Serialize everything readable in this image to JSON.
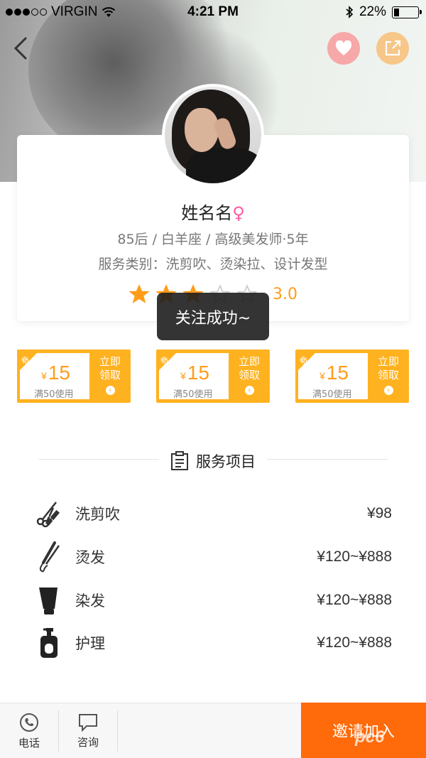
{
  "status": {
    "carrier": "VIRGIN",
    "time": "4:21 PM",
    "battery": "22%",
    "battery_level": 0.22
  },
  "header": {
    "back_icon": "chevron-left-icon",
    "like_icon": "heart-icon",
    "share_icon": "share-icon",
    "like_color": "#f7a8a8",
    "share_color": "#f7c689"
  },
  "profile": {
    "name": "姓名名",
    "gender_symbol": "♀",
    "details": "85后 / 白羊座 / 高级美发师·5年",
    "services_line": "服务类别：洗剪吹、烫染拉、设计发型",
    "rating_value": 3,
    "rating_max": 5,
    "rating_text": "3.0"
  },
  "toast": {
    "text": "关注成功~"
  },
  "coupons": [
    {
      "tag": "券",
      "currency": "¥",
      "amount": "15",
      "condition": "满50使用",
      "action_line1": "立即",
      "action_line2": "领取"
    },
    {
      "tag": "券",
      "currency": "¥",
      "amount": "15",
      "condition": "满50使用",
      "action_line1": "立即",
      "action_line2": "领取"
    },
    {
      "tag": "券",
      "currency": "¥",
      "amount": "15",
      "condition": "满50使用",
      "action_line1": "立即",
      "action_line2": "领取"
    }
  ],
  "services_section": {
    "title": "服务项目",
    "items": [
      {
        "icon": "scissors-comb-icon",
        "name": "洗剪吹",
        "price": "¥98"
      },
      {
        "icon": "curling-iron-icon",
        "name": "烫发",
        "price": "¥120~¥888"
      },
      {
        "icon": "dye-tube-icon",
        "name": "染发",
        "price": "¥120~¥888"
      },
      {
        "icon": "lotion-bottle-icon",
        "name": "护理",
        "price": "¥120~¥888"
      }
    ]
  },
  "bottom": {
    "phone_label": "电话",
    "consult_label": "咨询",
    "invite_label": "邀请加入",
    "invite_color": "#ff6a0a"
  },
  "colors": {
    "accent": "#ff9c1a",
    "coupon": "#ffb21f",
    "female": "#ff5aa5"
  }
}
